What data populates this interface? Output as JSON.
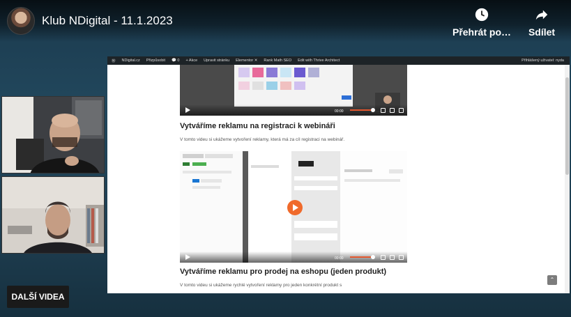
{
  "header": {
    "title": "Klub NDigital - 11.1.2023",
    "actions": [
      {
        "label": "Přehrát po…",
        "icon": "clock-icon"
      },
      {
        "label": "Sdílet",
        "icon": "share-arrow-icon"
      }
    ]
  },
  "admin_bar": {
    "site": "NDigital.cz",
    "customize": "Přizpůsobit",
    "comments_count": "0",
    "new": "Akce",
    "edit_page": "Upravit stránku",
    "elementor": "Elementor ✕",
    "seo": "Rank Math SEO",
    "edit_with": "Edit with Thrive Architect",
    "greeting": "Přihlášený uživatel: nyda"
  },
  "content": {
    "section1_heading": "Vytváříme reklamu na registraci k webináři",
    "section1_text": "V tomto videu si ukážeme vytvoření reklamy, která má za cíl registraci na webinář.",
    "section2_heading": "Vytváříme reklamu pro prodej na eshopu (jeden produkt)",
    "section2_text": "V tomto videu si ukážeme rychlé vytvoření reklamy pro jeden konkrétní produkt s",
    "video_time": "00:00"
  },
  "more_videos_label": "DALŠÍ VIDEA",
  "colors": {
    "accent": "#f06a2b",
    "admin_bar": "#1d2327"
  }
}
